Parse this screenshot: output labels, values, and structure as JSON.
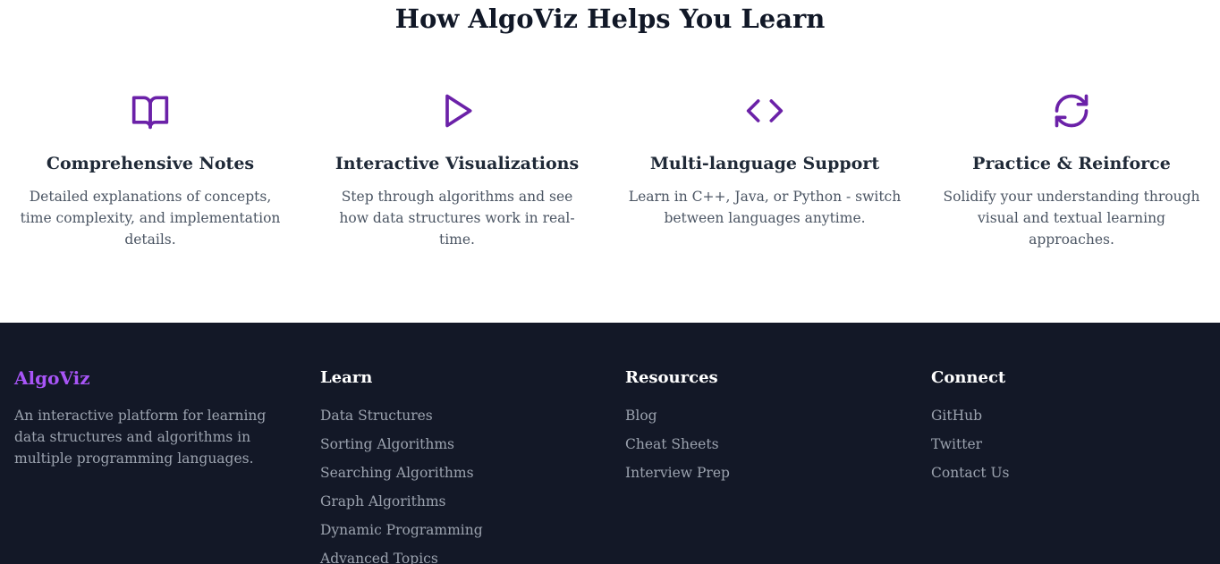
{
  "features_section": {
    "title": "How AlgoViz Helps You Learn",
    "accent_color": "#6b21a8",
    "items": [
      {
        "icon": "book-open-icon",
        "title": "Comprehensive Notes",
        "description": "Detailed explanations of concepts, time complexity, and implementation details."
      },
      {
        "icon": "play-icon",
        "title": "Interactive Visualizations",
        "description": "Step through algorithms and see how data structures work in real-time."
      },
      {
        "icon": "code-icon",
        "title": "Multi-language Support",
        "description": "Learn in C++, Java, or Python - switch between languages anytime."
      },
      {
        "icon": "refresh-icon",
        "title": "Practice & Reinforce",
        "description": "Solidify your understanding through visual and textual learning approaches."
      }
    ]
  },
  "footer": {
    "background_color": "#131827",
    "brand": {
      "name": "AlgoViz",
      "color": "#a855f7",
      "description": "An interactive platform for learning data structures and algorithms in multiple programming languages."
    },
    "columns": [
      {
        "heading": "Learn",
        "links": [
          "Data Structures",
          "Sorting Algorithms",
          "Searching Algorithms",
          "Graph Algorithms",
          "Dynamic Programming",
          "Advanced Topics"
        ]
      },
      {
        "heading": "Resources",
        "links": [
          "Blog",
          "Cheat Sheets",
          "Interview Prep"
        ]
      },
      {
        "heading": "Connect",
        "links": [
          "GitHub",
          "Twitter",
          "Contact Us"
        ]
      }
    ]
  }
}
